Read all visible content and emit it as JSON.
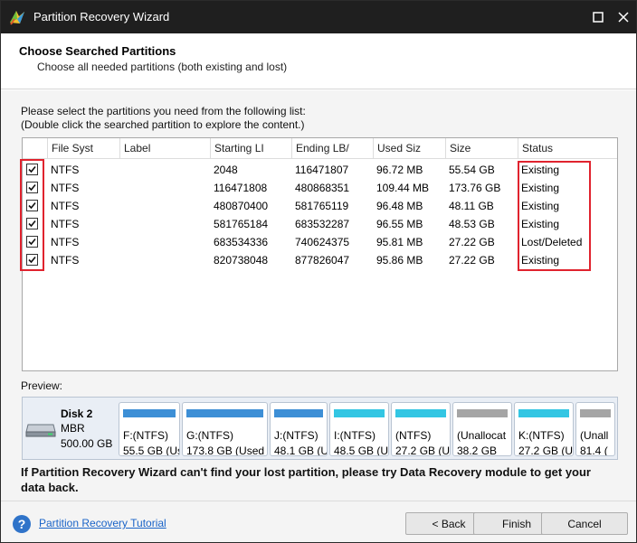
{
  "window": {
    "title": "Partition Recovery Wizard"
  },
  "header": {
    "title": "Choose Searched Partitions",
    "subtitle": "Choose all needed partitions (both existing and lost)"
  },
  "instructions": {
    "line1": "Please select the partitions you need from the following list:",
    "line2": "(Double click the searched partition to explore the content.)"
  },
  "table": {
    "columns": [
      "File Syst",
      "Label",
      "Starting LI",
      "Ending LB/",
      "Used Siz",
      "Size",
      "Status"
    ],
    "rows": [
      {
        "checked": true,
        "fs": "NTFS",
        "label": "",
        "start": "2048",
        "end": "116471807",
        "used": "96.72 MB",
        "size": "55.54 GB",
        "status": "Existing"
      },
      {
        "checked": true,
        "fs": "NTFS",
        "label": "",
        "start": "116471808",
        "end": "480868351",
        "used": "109.44 MB",
        "size": "173.76 GB",
        "status": "Existing"
      },
      {
        "checked": true,
        "fs": "NTFS",
        "label": "",
        "start": "480870400",
        "end": "581765119",
        "used": "96.48 MB",
        "size": "48.11 GB",
        "status": "Existing"
      },
      {
        "checked": true,
        "fs": "NTFS",
        "label": "",
        "start": "581765184",
        "end": "683532287",
        "used": "96.55 MB",
        "size": "48.53 GB",
        "status": "Existing"
      },
      {
        "checked": true,
        "fs": "NTFS",
        "label": "",
        "start": "683534336",
        "end": "740624375",
        "used": "95.81 MB",
        "size": "27.22 GB",
        "status": "Lost/Deleted"
      },
      {
        "checked": true,
        "fs": "NTFS",
        "label": "",
        "start": "820738048",
        "end": "877826047",
        "used": "95.86 MB",
        "size": "27.22 GB",
        "status": "Existing"
      }
    ]
  },
  "preview": {
    "label": "Preview:",
    "disk": {
      "name": "Disk 2",
      "type": "MBR",
      "size": "500.00 GB"
    },
    "partitions": [
      {
        "name": "F:(NTFS)",
        "size": "55.5 GB (Us",
        "color": "#3d8fd6"
      },
      {
        "name": "G:(NTFS)",
        "size": "173.8 GB (Used",
        "color": "#3d8fd6"
      },
      {
        "name": "J:(NTFS)",
        "size": "48.1 GB (U",
        "color": "#3d8fd6"
      },
      {
        "name": "I:(NTFS)",
        "size": "48.5 GB (U",
        "color": "#33c6e3"
      },
      {
        "name": "(NTFS)",
        "size": "27.2 GB (U",
        "color": "#33c6e3"
      },
      {
        "name": "(Unallocat",
        "size": "38.2 GB",
        "color": "#a5a5a5"
      },
      {
        "name": "K:(NTFS)",
        "size": "27.2 GB (U",
        "color": "#33c6e3"
      },
      {
        "name": "(Unall",
        "size": "81.4 (",
        "color": "#a5a5a5"
      }
    ]
  },
  "note": "If Partition Recovery Wizard can't find your lost partition, please try Data Recovery module to get your data back.",
  "footer": {
    "tutorial_link": "Partition Recovery Tutorial",
    "back_label": "< Back",
    "finish_label": "Finish",
    "cancel_label": "Cancel"
  },
  "colors": {
    "titlebar": "#1f1f1f",
    "highlight": "#e0232e",
    "link": "#1a64c8"
  }
}
